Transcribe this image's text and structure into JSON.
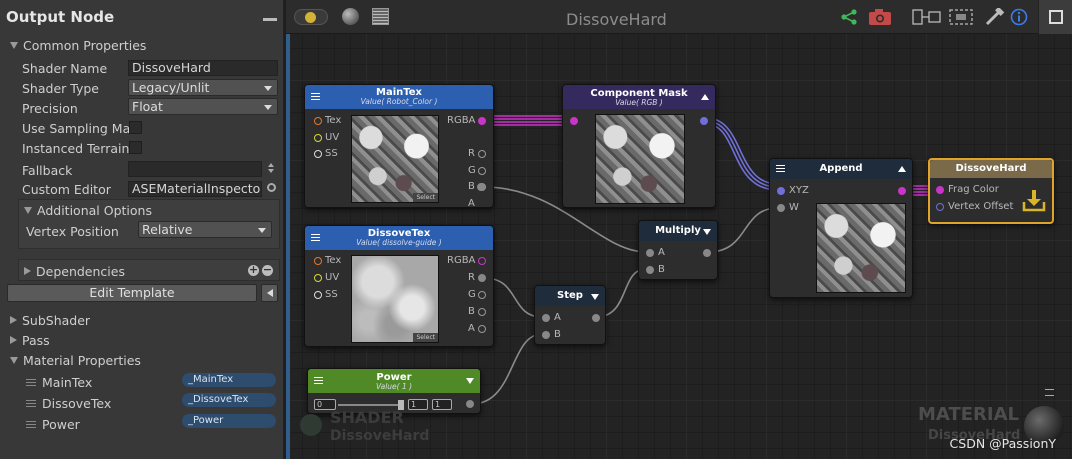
{
  "left_panel": {
    "title": "Output Node",
    "common_properties": "Common Properties",
    "shader_name_label": "Shader Name",
    "shader_name_value": "DissoveHard",
    "shader_type_label": "Shader Type",
    "shader_type_value": "Legacy/Unlit",
    "precision_label": "Precision",
    "precision_value": "Float",
    "use_sampling_label": "Use Sampling Mac",
    "instanced_terrain_label": "Instanced Terrain",
    "fallback_label": "Fallback",
    "fallback_value": "",
    "custom_editor_label": "Custom Editor",
    "custom_editor_value": "ASEMaterialInspector",
    "additional_options": "Additional Options",
    "vertex_position_label": "Vertex Position",
    "vertex_position_value": "Relative",
    "dependencies": "Dependencies",
    "edit_template": "Edit Template",
    "subshader": "SubShader",
    "pass": "Pass",
    "material_properties": "Material Properties",
    "mat_props": [
      {
        "label": "MainTex",
        "value": "_MainTex"
      },
      {
        "label": "DissoveTex",
        "value": "_DissoveTex"
      },
      {
        "label": "Power",
        "value": "_Power"
      }
    ]
  },
  "canvas": {
    "title": "DissoveHard",
    "watermark_material": "MATERIAL",
    "watermark_material_sub": "DissoveHard",
    "watermark_shader": "SHADER",
    "watermark_shader_sub": "DissoveHard",
    "credit": "CSDN @PassionY"
  },
  "nodes": {
    "maintex": {
      "title": "MainTex",
      "subtitle": "Value( Robot_Color )",
      "inputs": [
        "Tex",
        "UV",
        "SS"
      ],
      "outputs": [
        "RGBA",
        "R",
        "G",
        "B",
        "A"
      ],
      "select": "Select"
    },
    "dissovetex": {
      "title": "DissoveTex",
      "subtitle": "Value( dissolve-guide )",
      "inputs": [
        "Tex",
        "UV",
        "SS"
      ],
      "outputs": [
        "RGBA",
        "R",
        "G",
        "B",
        "A"
      ],
      "select": "Select"
    },
    "component_mask": {
      "title": "Component Mask",
      "subtitle": "Value( RGB )"
    },
    "multiply": {
      "title": "Multiply",
      "inputs": [
        "A",
        "B"
      ]
    },
    "step": {
      "title": "Step",
      "inputs": [
        "A",
        "B"
      ]
    },
    "power": {
      "title": "Power",
      "subtitle": "Value( 1 )",
      "min": "0",
      "value": "1",
      "max": "1"
    },
    "append": {
      "title": "Append",
      "inputs": [
        "XYZ",
        "W"
      ]
    },
    "output": {
      "title": "DissoveHard",
      "inputs": [
        "Frag Color",
        "Vertex Offset"
      ]
    }
  },
  "colors": {
    "texture_header": "#2d5fb0",
    "component_header": "#342a5e",
    "op_header": "#1f2c3c",
    "power_header": "#4f8a26",
    "output_header": "#7a6a4a",
    "output_border": "#e0a42a",
    "wire_magenta": "#c935c9",
    "wire_blue": "#7070d8",
    "wire_gray": "#8a8a8a"
  }
}
